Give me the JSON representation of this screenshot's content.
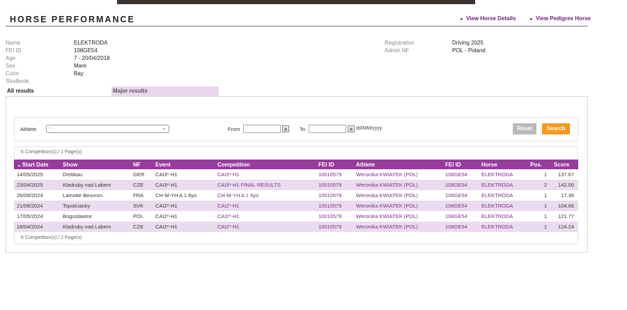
{
  "header": {
    "title": "HORSE PERFORMANCE",
    "link_details": "View Horse Details",
    "link_pedigree": "View Pedigree Horse"
  },
  "horse": {
    "name_label": "Name",
    "name": "ELEKTRODA",
    "feiid_label": "FEI ID",
    "feiid": "108GE54",
    "age_label": "Age",
    "age": "7 - 20/04/2018",
    "sex_label": "Sex",
    "sex": "Mare",
    "color_label": "Color",
    "color": "Bay",
    "studbook_label": "Studbook",
    "studbook": "",
    "registration_label": "Registration",
    "registration": "Driving 2025",
    "adminnf_label": "Admin NF",
    "adminnf": "POL - Poland"
  },
  "tabs": {
    "all": "All results",
    "major": "Major results"
  },
  "filter": {
    "athlete_label": "Athlete",
    "athlete_value": "-",
    "from_label": "From",
    "to_label": "To",
    "date_format": "dd/MM/yyyy",
    "reset": "Reset",
    "search": "Search"
  },
  "results": {
    "count_text": "6 Competition(s) / 1 Page(s)",
    "columns": [
      "Start Date",
      "Show",
      "NF",
      "Event",
      "Competition",
      "FEI ID",
      "Athlete",
      "FEI ID",
      "Horse",
      "Pos.",
      "Score"
    ],
    "rows": [
      [
        "14/05/2025",
        "Drebkau",
        "GER",
        "CAI3*-H1",
        "CAI3*-H1",
        "10010579",
        "Weronika KWIATEK (POL)",
        "108GE54",
        "ELEKTRODA",
        "1",
        "137.67"
      ],
      [
        "23/04/2025",
        "Kladruby nad Labem",
        "CZE",
        "CAI3*-H1",
        "CAI3*-H1 FINAL RESULTS",
        "10010579",
        "Weronika KWIATEK (POL)",
        "108GE54",
        "ELEKTRODA",
        "2",
        "142.00"
      ],
      [
        "26/09/2024",
        "Lamotte Beuvron",
        "FRA",
        "CH-M-YH A 1 6yo",
        "CH-M-YH A 1 6yo",
        "10010579",
        "Weronika KWIATEK (POL)",
        "108GE54",
        "ELEKTRODA",
        "1",
        "17.36"
      ],
      [
        "21/06/2024",
        "Topolcianky",
        "SVK",
        "CAI2*-H1",
        "CAI2*-H1",
        "10010579",
        "Weronika KWIATEK (POL)",
        "108GE54",
        "ELEKTRODA",
        "1",
        "104.66"
      ],
      [
        "17/05/2024",
        "Boguslawice",
        "POL",
        "CAI2*-H1",
        "CAI2*-H1",
        "10010579",
        "Weronika KWIATEK (POL)",
        "108GE54",
        "ELEKTRODA",
        "1",
        "121.77"
      ],
      [
        "18/04/2024",
        "Kladruby nad Labem",
        "CZE",
        "CAI2*-H1",
        "CAI2*-H1",
        "10010579",
        "Weronika KWIATEK (POL)",
        "108GE54",
        "ELEKTRODA",
        "1",
        "124.24"
      ]
    ]
  },
  "colors": {
    "accent": "#993a9f",
    "link": "#7a2b86",
    "row_alt": "#eadcee",
    "search": "#f39a1a",
    "reset": "#b9b9b9"
  }
}
